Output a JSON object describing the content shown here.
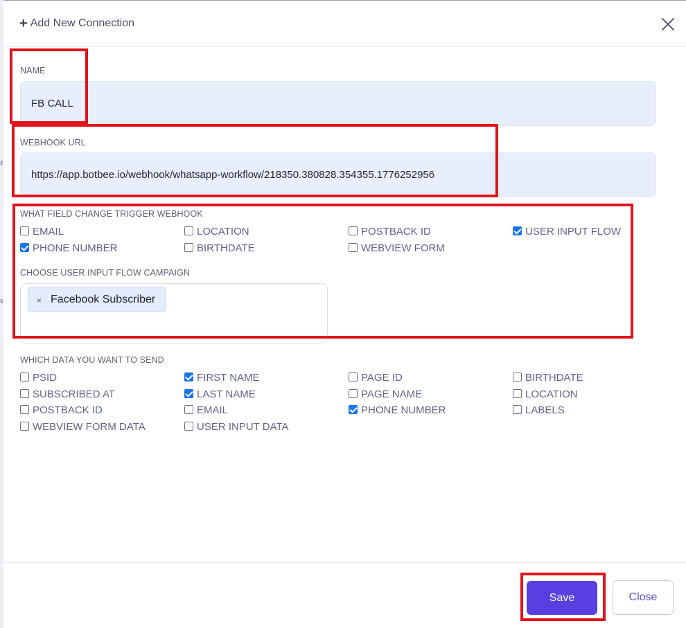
{
  "modal": {
    "title": "Add New Connection",
    "name_label": "NAME",
    "name_value": "FB CALL",
    "webhook_label": "WEBHOOK URL",
    "webhook_value": "https://app.botbee.io/webhook/whatsapp-workflow/218350.380828.354355.1776252956",
    "trigger_label": "WHAT FIELD CHANGE TRIGGER WEBHOOK",
    "trigger_fields": [
      {
        "label": "EMAIL",
        "checked": false
      },
      {
        "label": "LOCATION",
        "checked": false
      },
      {
        "label": "POSTBACK ID",
        "checked": false
      },
      {
        "label": "USER INPUT FLOW",
        "checked": true
      },
      {
        "label": "PHONE NUMBER",
        "checked": true
      },
      {
        "label": "BIRTHDATE",
        "checked": false
      },
      {
        "label": "WEBVIEW FORM",
        "checked": false
      }
    ],
    "campaign_label": "CHOOSE USER INPUT FLOW CAMPAIGN",
    "campaign_tags": [
      {
        "label": "Facebook Subscriber",
        "remove": "×"
      }
    ],
    "data_label": "WHICH DATA YOU WANT TO SEND",
    "data_fields": [
      {
        "label": "PSID",
        "checked": false
      },
      {
        "label": "FIRST NAME",
        "checked": true
      },
      {
        "label": "PAGE ID",
        "checked": false
      },
      {
        "label": "BIRTHDATE",
        "checked": false
      },
      {
        "label": "SUBSCRIBED AT",
        "checked": false
      },
      {
        "label": "LAST NAME",
        "checked": true
      },
      {
        "label": "PAGE NAME",
        "checked": false
      },
      {
        "label": "LOCATION",
        "checked": false
      },
      {
        "label": "POSTBACK ID",
        "checked": false
      },
      {
        "label": "EMAIL",
        "checked": false
      },
      {
        "label": "PHONE NUMBER",
        "checked": true
      },
      {
        "label": "LABELS",
        "checked": false
      },
      {
        "label": "WEBVIEW FORM DATA",
        "checked": false
      },
      {
        "label": "USER INPUT DATA",
        "checked": false
      }
    ],
    "save_label": "Save",
    "close_label": "Close"
  },
  "colors": {
    "primary": "#5a3fe0",
    "checkbox_checked": "#1a73e8",
    "input_bg": "#e8effc",
    "highlight": "#e0141b"
  },
  "icons": {
    "title": "plus-icon",
    "dismiss": "close-icon",
    "tag_remove": "remove-tag-icon"
  }
}
